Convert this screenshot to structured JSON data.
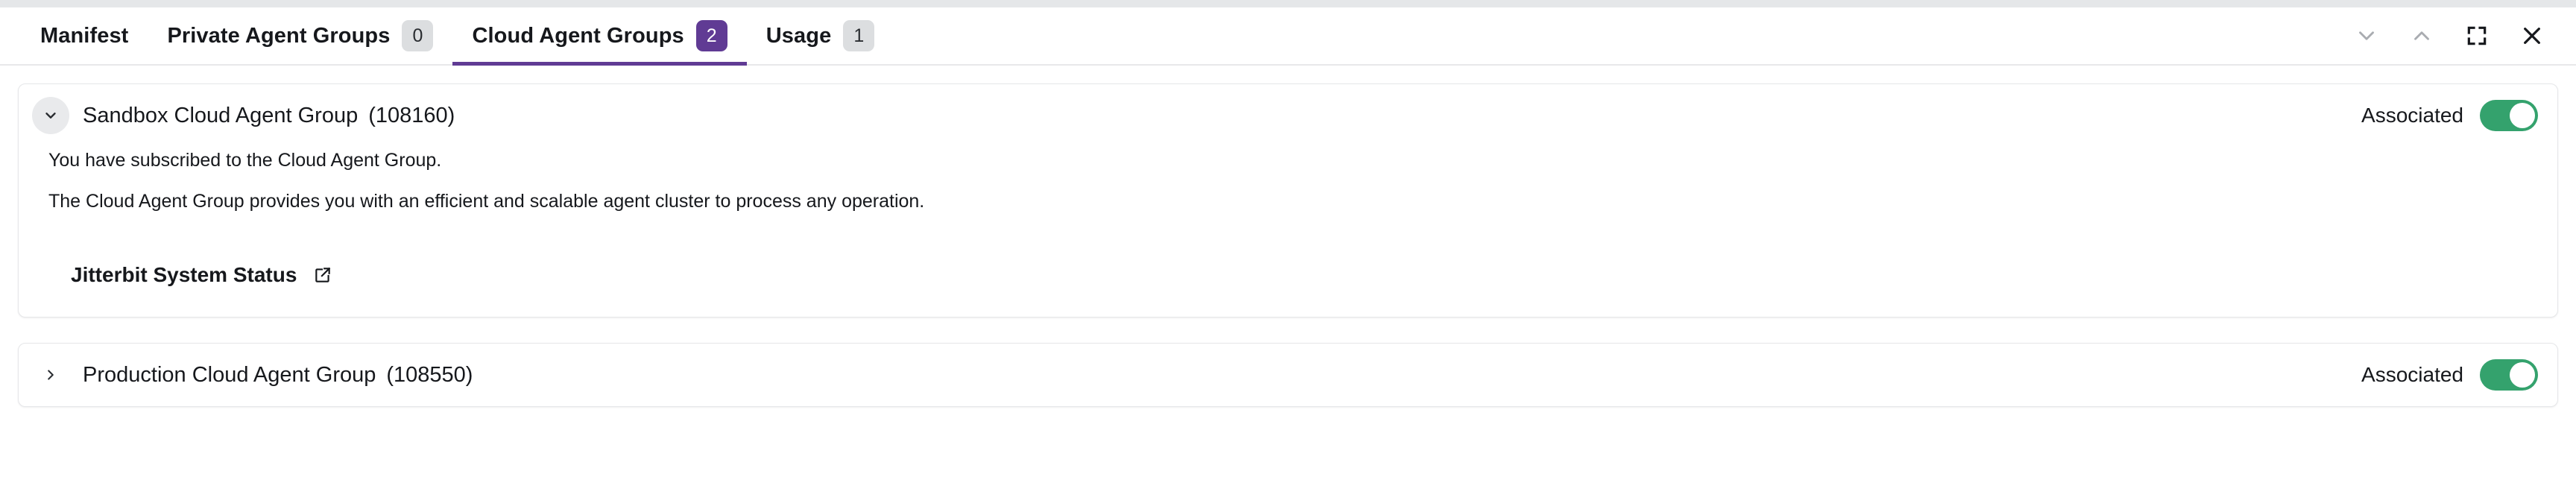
{
  "window": {
    "controls": [
      {
        "name": "chevron-down-icon",
        "label": "Collapse"
      },
      {
        "name": "chevron-up-icon",
        "label": "Expand"
      },
      {
        "name": "fullscreen-icon",
        "label": "Fullscreen"
      },
      {
        "name": "close-icon",
        "label": "Close"
      }
    ]
  },
  "tabs": [
    {
      "label": "Manifest",
      "badge": null,
      "active": false
    },
    {
      "label": "Private Agent Groups",
      "badge": "0",
      "active": false
    },
    {
      "label": "Cloud Agent Groups",
      "badge": "2",
      "active": true
    },
    {
      "label": "Usage",
      "badge": "1",
      "active": false
    }
  ],
  "colors": {
    "accent_purple": "#603b94",
    "toggle_green": "#34a26d",
    "badge_gray": "#dcdee0",
    "top_strip": "#e5e7e9"
  },
  "cards": [
    {
      "title": "Sandbox Cloud Agent Group",
      "id": "(108160)",
      "expanded": true,
      "association": {
        "label": "Associated",
        "enabled": true
      },
      "body_lines": [
        "You have subscribed to the Cloud Agent Group.",
        "The Cloud Agent Group provides you with an efficient and scalable agent cluster to process any operation."
      ],
      "link": {
        "text": "Jitterbit System Status",
        "icon": "external-link-icon"
      }
    },
    {
      "title": "Production Cloud Agent Group",
      "id": "(108550)",
      "expanded": false,
      "association": {
        "label": "Associated",
        "enabled": true
      }
    }
  ]
}
